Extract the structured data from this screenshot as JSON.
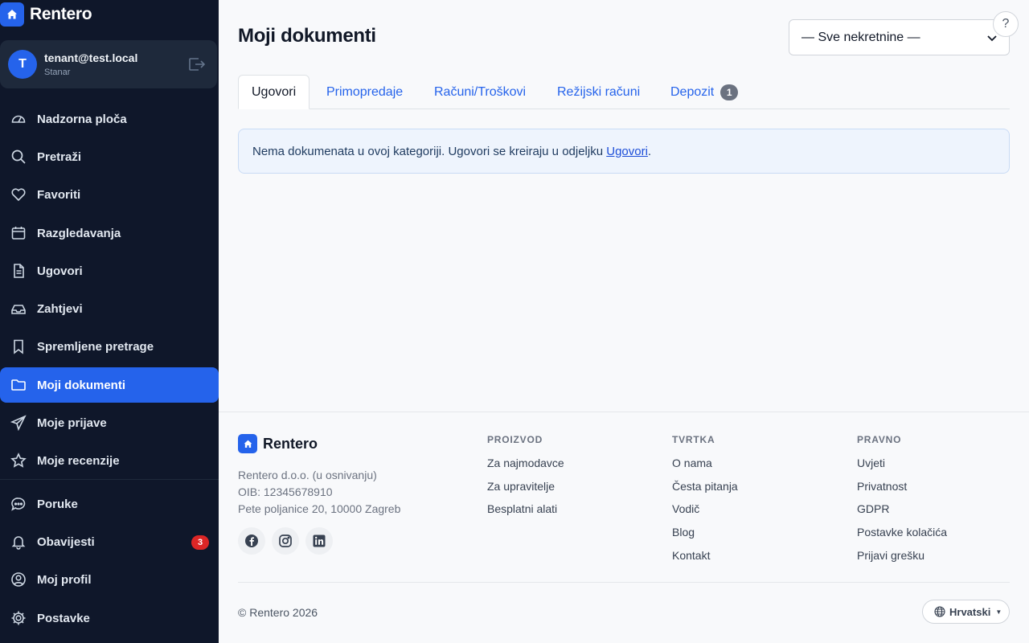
{
  "brand": {
    "name": "Rentero",
    "icon": "house-icon"
  },
  "user": {
    "initial": "T",
    "email": "tenant@test.local",
    "role": "Stanar"
  },
  "sidebar": {
    "items": [
      {
        "label": "Nadzorna ploča",
        "icon": "gauge-icon"
      },
      {
        "label": "Pretraži",
        "icon": "search-icon"
      },
      {
        "label": "Favoriti",
        "icon": "heart-icon"
      },
      {
        "label": "Razgledavanja",
        "icon": "calendar-icon"
      },
      {
        "label": "Ugovori",
        "icon": "document-icon"
      },
      {
        "label": "Zahtjevi",
        "icon": "inbox-icon"
      },
      {
        "label": "Spremljene pretrage",
        "icon": "bookmark-icon"
      },
      {
        "label": "Moji dokumenti",
        "icon": "folder-icon",
        "active": true
      },
      {
        "label": "Moje prijave",
        "icon": "send-icon"
      },
      {
        "label": "Moje recenzije",
        "icon": "star-icon"
      },
      {
        "label": "Poruke",
        "icon": "chat-icon"
      },
      {
        "label": "Obavijesti",
        "icon": "bell-icon",
        "badge": "3"
      },
      {
        "label": "Moj profil",
        "icon": "user-circle-icon"
      },
      {
        "label": "Postavke",
        "icon": "gear-icon"
      }
    ]
  },
  "header": {
    "title": "Moji dokumenti",
    "property_select": "— Sve nekretnine —",
    "help": "?"
  },
  "tabs": [
    {
      "label": "Ugovori",
      "active": true
    },
    {
      "label": "Primopredaje"
    },
    {
      "label": "Računi/Troškovi"
    },
    {
      "label": "Režijski računi"
    },
    {
      "label": "Depozit",
      "badge": "1"
    }
  ],
  "alert": {
    "text": "Nema dokumenata u ovoj kategoriji. Ugovori se kreiraju u odjeljku ",
    "link": "Ugovori",
    "suffix": "."
  },
  "footer": {
    "brand": "Rentero",
    "company": "Rentero d.o.o. (u osnivanju)",
    "oib": "OIB: 12345678910",
    "address": "Pete poljanice 20, 10000 Zagreb",
    "social": [
      "facebook-icon",
      "instagram-icon",
      "linkedin-icon"
    ],
    "columns": [
      {
        "heading": "PROIZVOD",
        "links": [
          "Za najmodavce",
          "Za upravitelje",
          "Besplatni alati"
        ]
      },
      {
        "heading": "TVRTKA",
        "links": [
          "O nama",
          "Česta pitanja",
          "Vodič",
          "Blog",
          "Kontakt"
        ]
      },
      {
        "heading": "PRAVNO",
        "links": [
          "Uvjeti",
          "Privatnost",
          "GDPR",
          "Postavke kolačića",
          "Prijavi grešku"
        ]
      }
    ],
    "copyright": "© Rentero 2026",
    "language": "Hrvatski"
  },
  "colors": {
    "sidebar_bg": "#0f172a",
    "accent": "#2563eb",
    "badge_red": "#dc2626"
  }
}
